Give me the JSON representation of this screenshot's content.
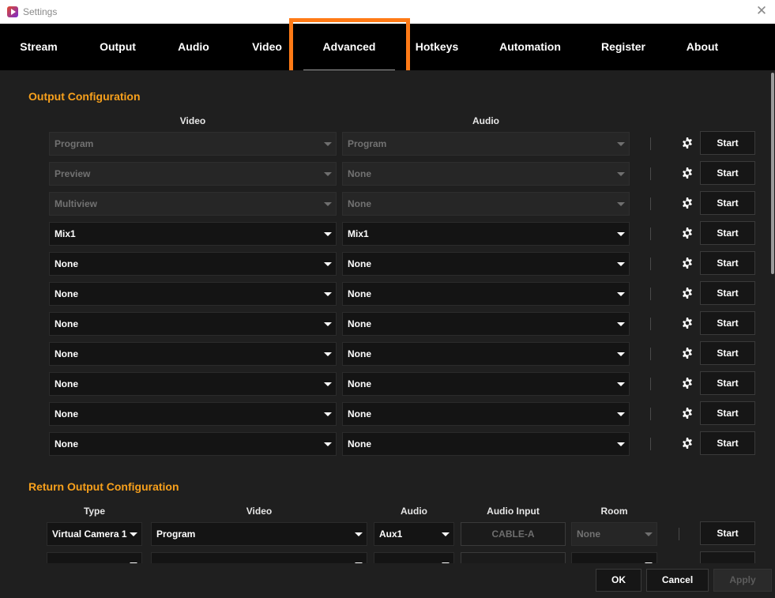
{
  "window": {
    "title": "Settings"
  },
  "tabs": [
    "Stream",
    "Output",
    "Audio",
    "Video",
    "Advanced",
    "Hotkeys",
    "Automation",
    "Register",
    "About"
  ],
  "active_tab": "Advanced",
  "output_config": {
    "title": "Output Configuration",
    "video_header": "Video",
    "audio_header": "Audio",
    "start_label": "Start",
    "rows": [
      {
        "video": "Program",
        "audio": "Program",
        "disabled": true
      },
      {
        "video": "Preview",
        "audio": "None",
        "disabled": true
      },
      {
        "video": "Multiview",
        "audio": "None",
        "disabled": true
      },
      {
        "video": "Mix1",
        "audio": "Mix1",
        "disabled": false
      },
      {
        "video": "None",
        "audio": "None",
        "disabled": false
      },
      {
        "video": "None",
        "audio": "None",
        "disabled": false
      },
      {
        "video": "None",
        "audio": "None",
        "disabled": false
      },
      {
        "video": "None",
        "audio": "None",
        "disabled": false
      },
      {
        "video": "None",
        "audio": "None",
        "disabled": false
      },
      {
        "video": "None",
        "audio": "None",
        "disabled": false
      },
      {
        "video": "None",
        "audio": "None",
        "disabled": false
      }
    ]
  },
  "return_config": {
    "title": "Return Output Configuration",
    "headers": {
      "type": "Type",
      "video": "Video",
      "audio": "Audio",
      "audio_input": "Audio Input",
      "room": "Room"
    },
    "start_label": "Start",
    "row": {
      "type": "Virtual Camera 1",
      "video": "Program",
      "audio": "Aux1",
      "audio_input": "CABLE-A",
      "room": "None"
    }
  },
  "footer": {
    "ok": "OK",
    "cancel": "Cancel",
    "apply": "Apply"
  },
  "colors": {
    "accent": "#f7a01c",
    "highlight": "#ff7a16",
    "background": "#1f1f1f",
    "tabbar": "#000000"
  }
}
